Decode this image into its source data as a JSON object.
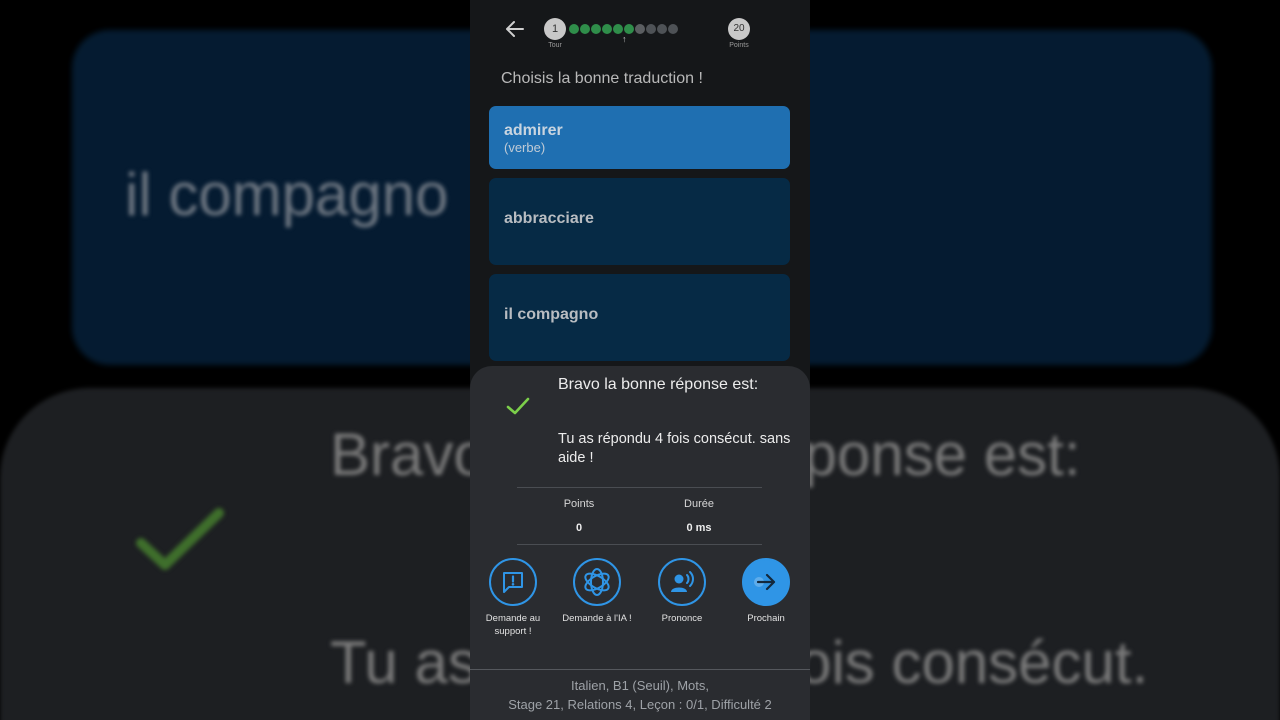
{
  "background": {
    "card_text": "il compagno",
    "sheet_title": "Bravo la bonne réponse est:",
    "sheet_line2": "Tu as répondu 4 fois consécut."
  },
  "header": {
    "round_number": "1",
    "round_label": "Tour",
    "points_number": "20",
    "points_label": "Points",
    "progress": [
      "done",
      "done",
      "done",
      "done",
      "done",
      "done",
      "current",
      "todo",
      "todo",
      "todo"
    ]
  },
  "prompt": "Choisis la bonne traduction !",
  "options": [
    {
      "word": "admirer",
      "sub": "(verbe)",
      "selected": true
    },
    {
      "word": "abbracciare",
      "sub": "",
      "selected": false
    },
    {
      "word": "il compagno",
      "sub": "",
      "selected": false
    }
  ],
  "result": {
    "title": "Bravo la bonne réponse est:",
    "message": "Tu as répondu 4 fois consécut. sans aide !",
    "stats": {
      "points_label": "Points",
      "points_value": "0",
      "duration_label": "Durée",
      "duration_value": "0 ms"
    },
    "actions": [
      {
        "label": "Demande au support !",
        "icon": "support-alert-icon"
      },
      {
        "label": "Demande à l'IA !",
        "icon": "ai-openai-icon"
      },
      {
        "label": "Prononce",
        "icon": "speak-icon"
      },
      {
        "label": "Prochain",
        "icon": "arrow-right-icon"
      }
    ]
  },
  "footer": {
    "line1": "Italien, B1 (Seuil), Mots,",
    "line2": "Stage 21, Relations 4, Leçon : 0/1, Difficulté 2"
  },
  "colors": {
    "accent": "#2f95e6",
    "selected_option": "#1f6fb1",
    "option": "#062a45",
    "success": "#7ccf4a",
    "progress_done": "#2f8e4a"
  }
}
